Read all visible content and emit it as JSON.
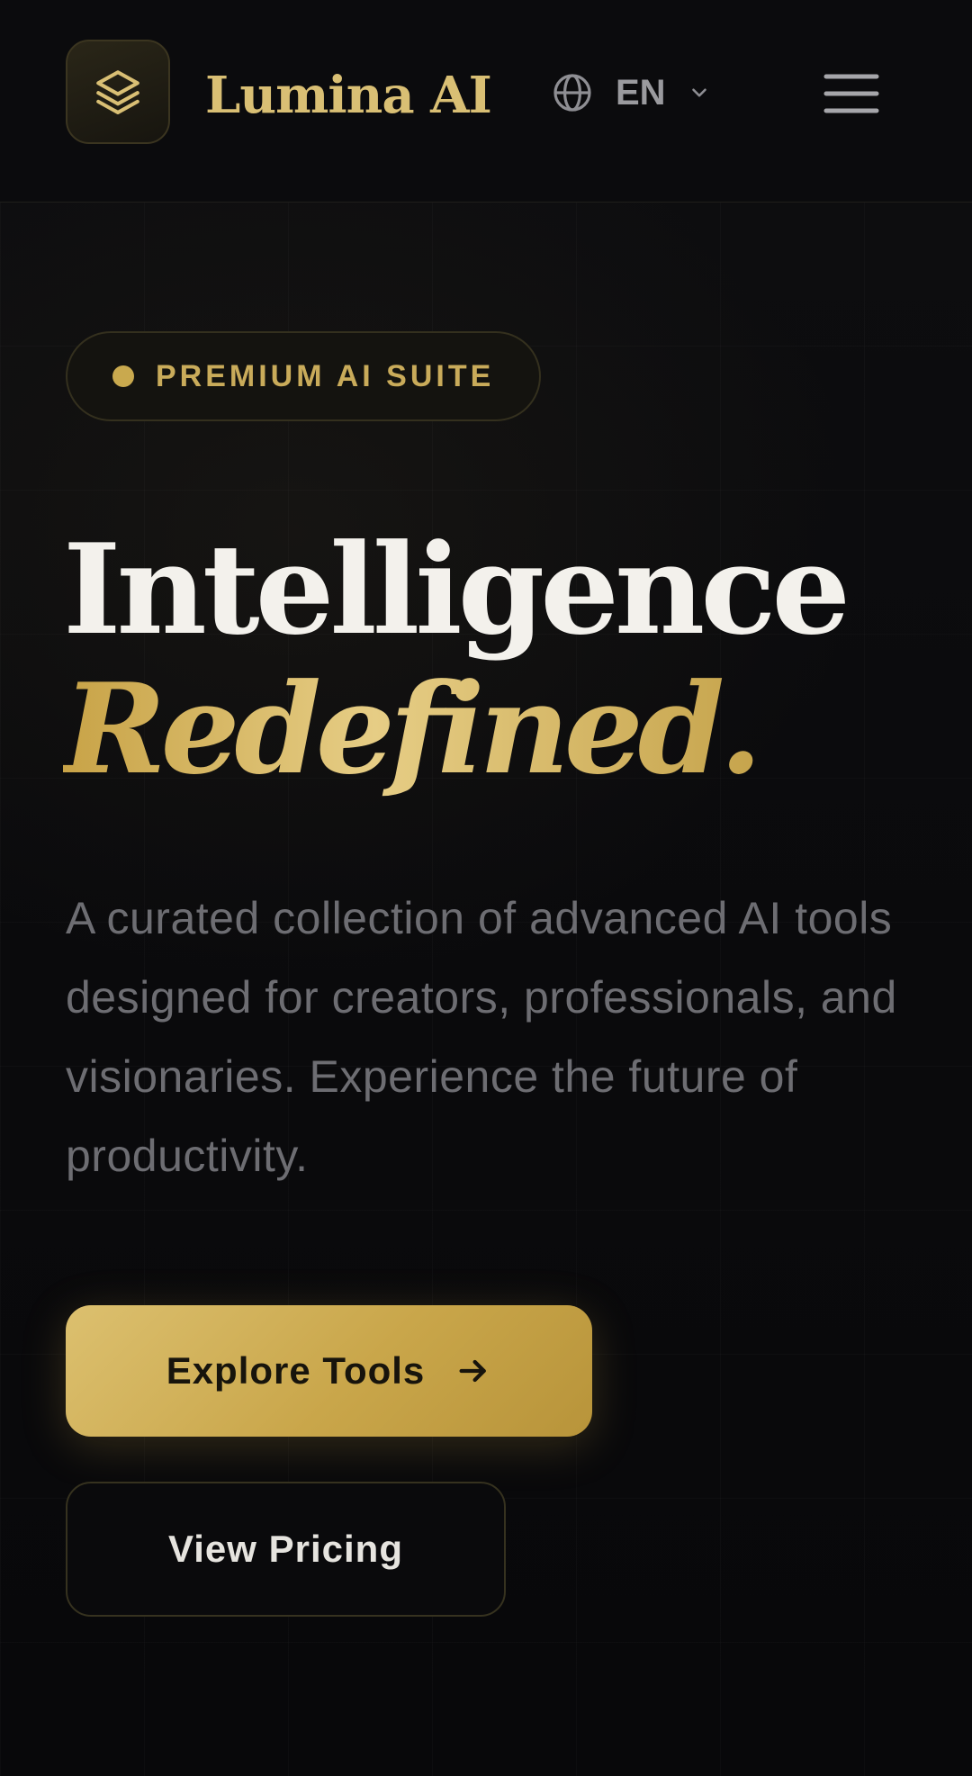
{
  "header": {
    "brand": "Lumina AI",
    "logo_icon": "layers-icon",
    "language": {
      "icon": "globe-icon",
      "code": "EN",
      "chevron": "chevron-down-icon"
    },
    "menu_icon": "hamburger-menu-icon"
  },
  "hero": {
    "badge": "PREMIUM AI SUITE",
    "headline_line1": "Intelligence",
    "headline_line2": "Redefined.",
    "description": "A curated collection of advanced AI tools designed for creators, professionals, and visionaries. Experience the future of productivity.",
    "primary_cta": "Explore Tools",
    "primary_cta_icon": "arrow-right-icon",
    "secondary_cta": "View Pricing"
  },
  "colors": {
    "background": "#0b0b0d",
    "gold": "#c9a94e",
    "gold_light": "#e6cd85",
    "text_primary": "#f3f1ec",
    "text_muted": "#6d6d72"
  }
}
